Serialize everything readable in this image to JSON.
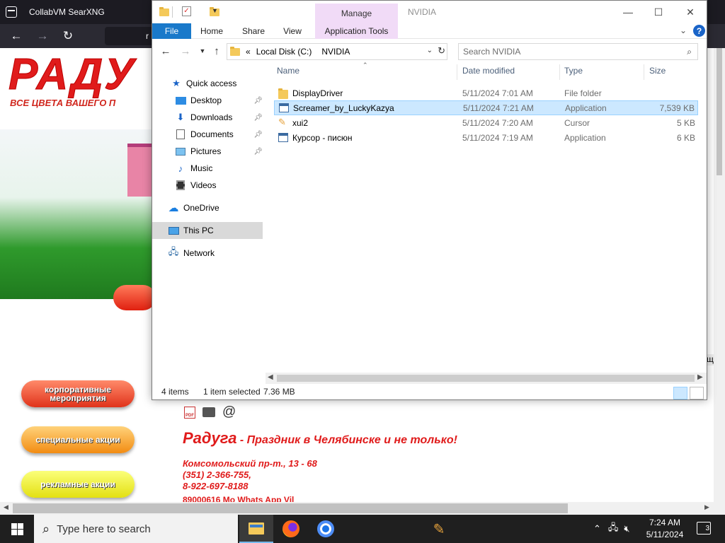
{
  "browser": {
    "tab_title": "CollabVM SearXNG",
    "url_fragment": "r"
  },
  "webpage": {
    "logo_text": "РАДУ",
    "logo_subtitle": "ВСЕ ЦВЕТА ВАШЕГО П",
    "side_buttons": [
      {
        "label": "корпоративные мероприятия"
      },
      {
        "label": "специальные акции"
      },
      {
        "label": "рекламные акции"
      }
    ],
    "pdf_label": "PDF",
    "at_symbol": "@",
    "headline_big": "Радуга",
    "headline_rest": " - Праздник в Челябинске и не только!",
    "address_line1": "Комсомольский пр-т., 13 - 68",
    "address_line2": "(351) 2-366-755,",
    "address_line3": "8-922-697-8188",
    "cut_line": "89000616 Mo Whats App Vil",
    "right_fragment": "щ"
  },
  "explorer": {
    "title": "NVIDIA",
    "manage_tab": "Manage",
    "ribbon_tabs": [
      "File",
      "Home",
      "Share",
      "View",
      "Application Tools"
    ],
    "help_symbol": "?",
    "address": {
      "prefix": "«",
      "segments": [
        "Local Disk (C:)",
        "NVIDIA"
      ]
    },
    "search_placeholder": "Search NVIDIA",
    "nav": {
      "quick_access": "Quick access",
      "items": [
        {
          "label": "Desktop",
          "pinned": true
        },
        {
          "label": "Downloads",
          "pinned": true
        },
        {
          "label": "Documents",
          "pinned": true
        },
        {
          "label": "Pictures",
          "pinned": true
        },
        {
          "label": "Music",
          "pinned": false
        },
        {
          "label": "Videos",
          "pinned": false
        }
      ],
      "onedrive": "OneDrive",
      "this_pc": "This PC",
      "network": "Network"
    },
    "columns": {
      "name": "Name",
      "date": "Date modified",
      "type": "Type",
      "size": "Size"
    },
    "files": [
      {
        "name": "DisplayDriver",
        "date": "5/11/2024 7:01 AM",
        "type": "File folder",
        "size": "",
        "icon": "folder-icon"
      },
      {
        "name": "Screamer_by_LuckyKazya",
        "date": "5/11/2024 7:21 AM",
        "type": "Application",
        "size": "7,539 KB",
        "icon": "application-icon",
        "selected": true
      },
      {
        "name": "xui2",
        "date": "5/11/2024 7:20 AM",
        "type": "Cursor",
        "size": "5 KB",
        "icon": "cursor-icon"
      },
      {
        "name": "Курсор - писюн",
        "date": "5/11/2024 7:19 AM",
        "type": "Application",
        "size": "6 KB",
        "icon": "application-icon"
      }
    ],
    "status": {
      "count": "4 items",
      "selected": "1 item selected",
      "selected_size": "7.36 MB"
    }
  },
  "taskbar": {
    "search_placeholder": "Type here to search",
    "clock_time": "7:24 AM",
    "clock_date": "5/11/2024",
    "notification_count": "3"
  },
  "colors": {
    "selection": "#cce8ff",
    "file_tab": "#1979ca",
    "manage_tab": "#f1dbf7",
    "taskbar": "#1f1f1f",
    "web_red": "#e01b1b"
  }
}
